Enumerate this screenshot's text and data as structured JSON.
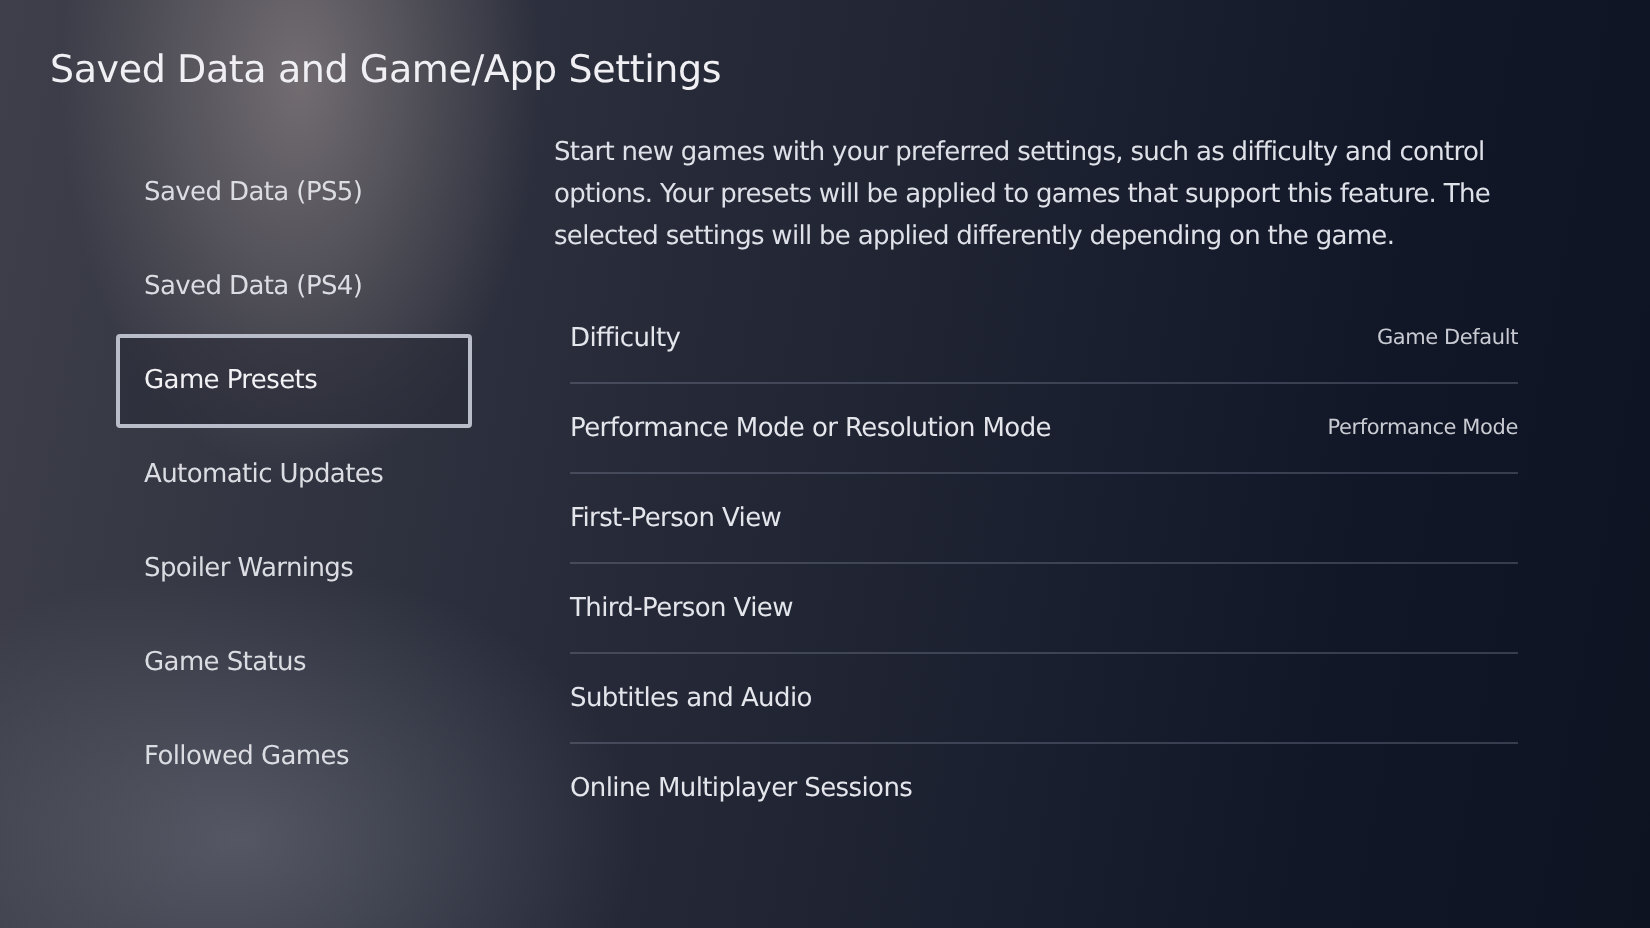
{
  "title": "Saved Data and Game/App Settings",
  "sidebar": {
    "items": [
      {
        "label": "Saved Data (PS5)",
        "selected": false
      },
      {
        "label": "Saved Data (PS4)",
        "selected": false
      },
      {
        "label": "Game Presets",
        "selected": true
      },
      {
        "label": "Automatic Updates",
        "selected": false
      },
      {
        "label": "Spoiler Warnings",
        "selected": false
      },
      {
        "label": "Game Status",
        "selected": false
      },
      {
        "label": "Followed Games",
        "selected": false
      }
    ]
  },
  "description": "Start new games with your preferred settings, such as difficulty and control options. Your presets will be applied to games that support this feature. The selected settings will be applied differently depending on the game.",
  "settings": [
    {
      "label": "Difficulty",
      "value": "Game Default"
    },
    {
      "label": "Performance Mode or Resolution Mode",
      "value": "Performance Mode"
    },
    {
      "label": "First-Person View"
    },
    {
      "label": "Third-Person View"
    },
    {
      "label": "Subtitles and Audio"
    },
    {
      "label": "Online Multiplayer Sessions"
    }
  ]
}
